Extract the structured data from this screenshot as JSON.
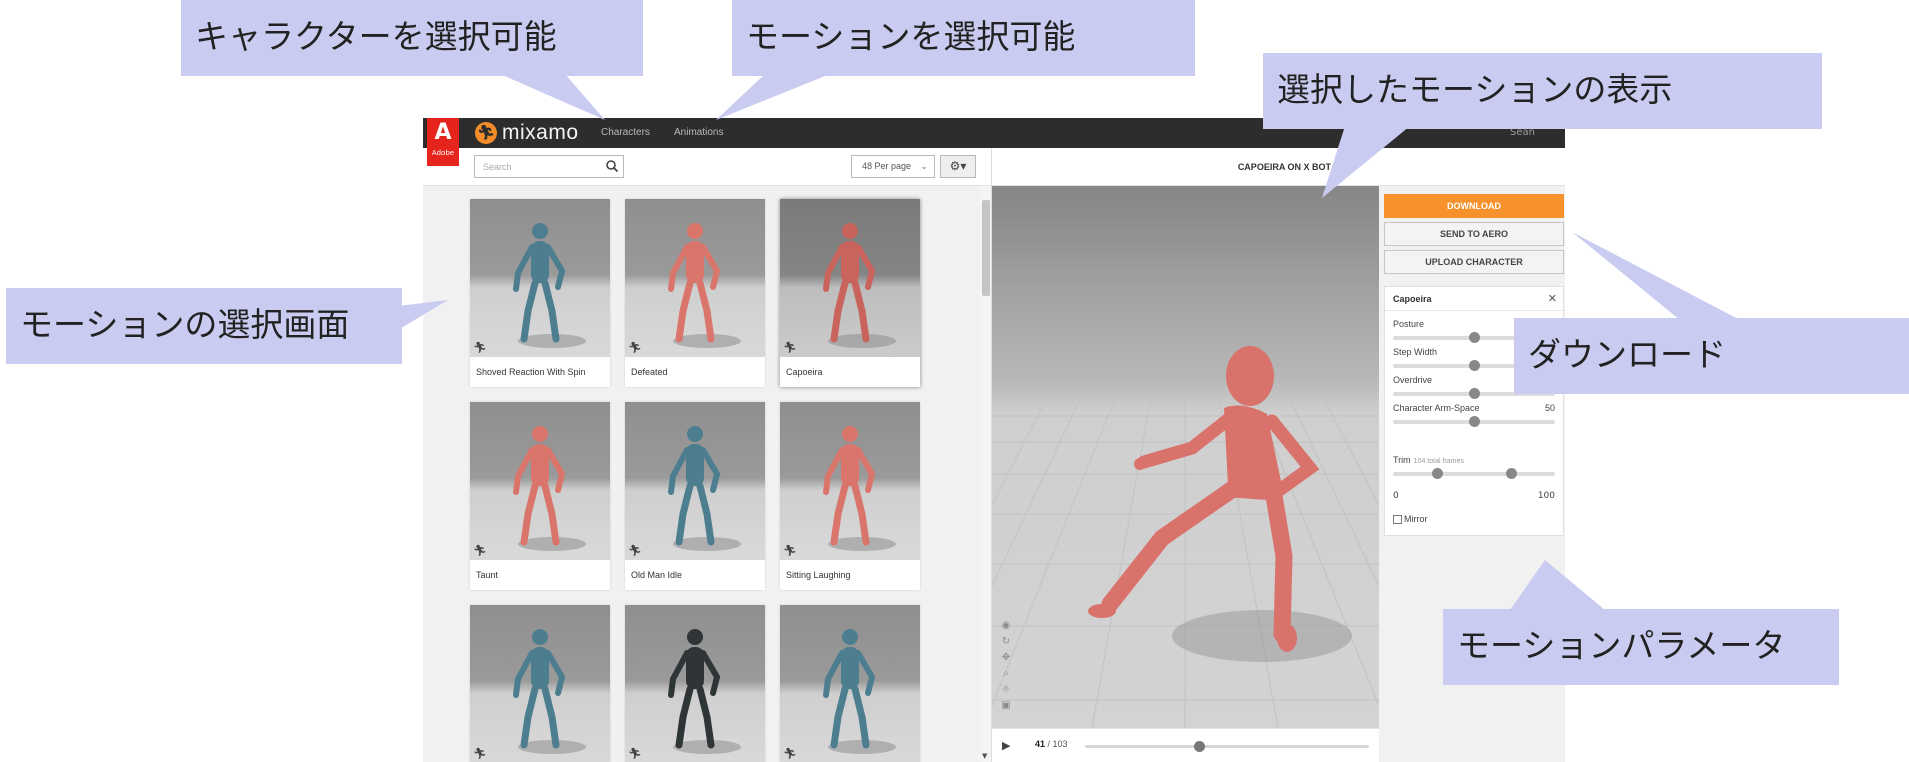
{
  "annotations": {
    "character_select": "キャラクターを選択可能",
    "motion_select": "モーションを選択可能",
    "selected_motion_view": "選択したモーションの表示",
    "motion_list": "モーションの選択画面",
    "download": "ダウンロード",
    "motion_params": "モーションパラメータ"
  },
  "app": {
    "brand_badge": "Adobe",
    "logo": "mixamo",
    "nav": {
      "characters": "Characters",
      "animations": "Animations"
    },
    "header_right": "Sean"
  },
  "search": {
    "placeholder": "Search"
  },
  "per_page": {
    "selected": "48 Per page"
  },
  "gear_icon": "gear-icon",
  "grid": {
    "cards": [
      {
        "label": "Shoved Reaction With Spin",
        "color": "#4d7e8f"
      },
      {
        "label": "Defeated",
        "color": "#d9756b"
      },
      {
        "label": "Capoeira",
        "color": "#c9645c",
        "selected": true
      },
      {
        "label": "Taunt",
        "color": "#d9756b"
      },
      {
        "label": "Old Man Idle",
        "color": "#4d7e8f"
      },
      {
        "label": "Sitting Laughing",
        "color": "#d9756b"
      },
      {
        "label": "",
        "color": "#4d7e8f"
      },
      {
        "label": "",
        "color": "#2f3436"
      },
      {
        "label": "",
        "color": "#4d7e8f"
      }
    ]
  },
  "viewer": {
    "title": "CAPOEIRA ON X BOT",
    "character_color": "#d9726a"
  },
  "timeline": {
    "current_frame": "41",
    "total_frames": "/ 103",
    "progress": 0.4
  },
  "actions": {
    "download": "DOWNLOAD",
    "send_to_aero": "SEND TO AERO",
    "upload_character": "UPLOAD CHARACTER"
  },
  "params": {
    "title": "Capoeira",
    "items": [
      {
        "label": "Posture",
        "value": "",
        "level": 0.5
      },
      {
        "label": "Step Width",
        "value": "",
        "level": 0.5
      },
      {
        "label": "Overdrive",
        "value": "50",
        "level": 0.5
      },
      {
        "label": "Character Arm-Space",
        "value": "50",
        "level": 0.5
      }
    ],
    "trim": {
      "label": "Trim",
      "note": "104 total frames",
      "min": "0",
      "max": "100",
      "start": 0.27,
      "end": 0.73
    },
    "mirror": "Mirror"
  },
  "colors": {
    "accent": "#f7912b",
    "callout": "#c9ccf0",
    "topbar": "#2d2d2d",
    "adobe": "#e5241e"
  }
}
